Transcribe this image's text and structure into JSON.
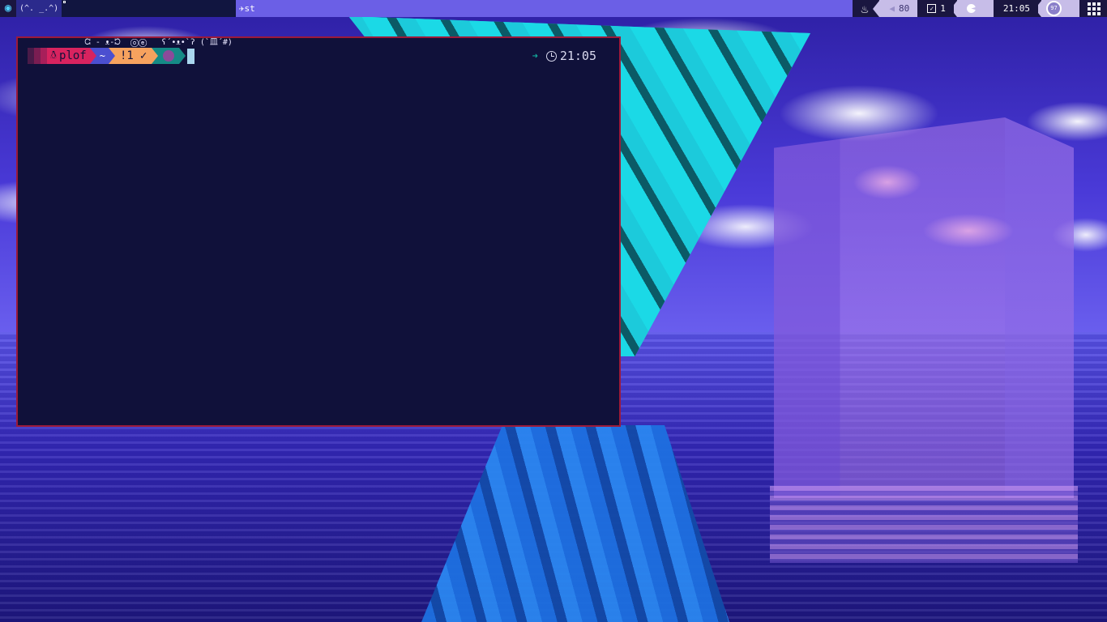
{
  "topbar": {
    "logo_icon": "eye-icon",
    "workspaces": [
      {
        "label": "(^. _.^)"
      },
      {
        "label": "ᘳ - ᴥ-ᘰ  ⓞⓔ   ʕ´•ᴥ•`ʔ (`皿´#)"
      }
    ],
    "window_title": "✈st",
    "tray": {
      "volume_icon": "speaker-icon",
      "volume": "80",
      "tasks_icon": "checkbox-icon",
      "tasks": "1",
      "pacman_icon": "pacman-icon",
      "time": "21:05",
      "battery": "97",
      "menu_icon": "grid-menu-icon"
    }
  },
  "terminal": {
    "user": "plof",
    "dir": "~",
    "git_status": "!1",
    "git_ok": "✓",
    "time": "21:05"
  },
  "colors": {
    "bar_bg": "#6b5fe6",
    "terminal_bg": "#10113a",
    "terminal_border": "#9c1a3a",
    "user_seg": "#d8235f",
    "git_seg": "#f6a25e",
    "teal": "#158a86"
  }
}
